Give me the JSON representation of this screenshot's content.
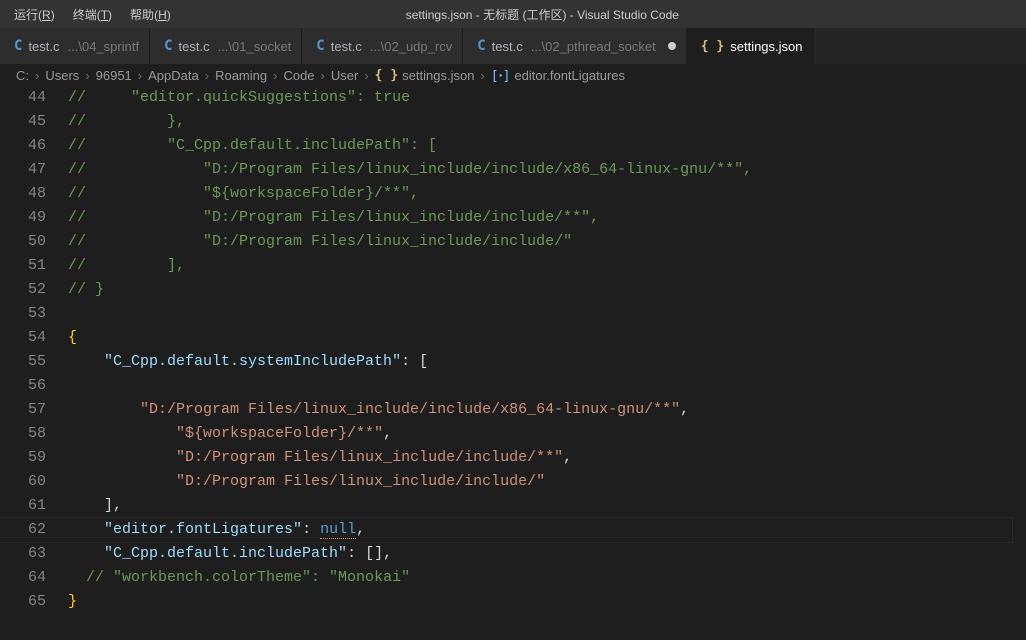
{
  "menubar": {
    "run": {
      "label": "运行",
      "accel": "R"
    },
    "term": {
      "label": "终端",
      "accel": "T"
    },
    "help": {
      "label": "帮助",
      "accel": "H"
    }
  },
  "title": "settings.json - 无标题 (工作区) - Visual Studio Code",
  "tabs": [
    {
      "icon": "C",
      "name": "test.c",
      "path": "...\\04_sprintf",
      "dirty": false,
      "active": false
    },
    {
      "icon": "C",
      "name": "test.c",
      "path": "...\\01_socket",
      "dirty": false,
      "active": false
    },
    {
      "icon": "C",
      "name": "test.c",
      "path": "...\\02_udp_rcv",
      "dirty": false,
      "active": false
    },
    {
      "icon": "C",
      "name": "test.c",
      "path": "...\\02_pthread_socket",
      "dirty": true,
      "active": false
    },
    {
      "icon": "{}",
      "name": "settings.json",
      "path": "",
      "dirty": false,
      "active": true
    }
  ],
  "breadcrumb": {
    "path": [
      "C:",
      "Users",
      "96951",
      "AppData",
      "Roaming",
      "Code",
      "User"
    ],
    "file": "settings.json",
    "symbol": "editor.fontLigatures",
    "symbol_icon": "[ꞏ]"
  },
  "firstLine": 44,
  "currentLine": 62,
  "code": [
    [
      {
        "cls": "tok-comment",
        "t": "// "
      },
      {
        "cls": "tok-comment",
        "t": "    \"editor.quickSuggestions\": true"
      }
    ],
    [
      {
        "cls": "tok-comment",
        "t": "//         },"
      }
    ],
    [
      {
        "cls": "tok-comment",
        "t": "//         \"C_Cpp.default.includePath\": ["
      }
    ],
    [
      {
        "cls": "tok-comment",
        "t": "//             \"D:/Program Files/linux_include/include/x86_64-linux-gnu/**\","
      }
    ],
    [
      {
        "cls": "tok-comment",
        "t": "//             \"${workspaceFolder}/**\","
      }
    ],
    [
      {
        "cls": "tok-comment",
        "t": "//             \"D:/Program Files/linux_include/include/**\","
      }
    ],
    [
      {
        "cls": "tok-comment",
        "t": "//             \"D:/Program Files/linux_include/include/\""
      }
    ],
    [
      {
        "cls": "tok-comment",
        "t": "//         ],"
      }
    ],
    [
      {
        "cls": "tok-comment",
        "t": "// }"
      }
    ],
    [],
    [
      {
        "cls": "tok-brace",
        "t": "{"
      }
    ],
    [
      {
        "cls": "tok-punc",
        "t": "    "
      },
      {
        "cls": "tok-prop",
        "t": "\"C_Cpp.default.systemIncludePath\""
      },
      {
        "cls": "tok-punc",
        "t": ": ["
      }
    ],
    [],
    [
      {
        "cls": "tok-punc",
        "t": "        "
      },
      {
        "cls": "tok-string",
        "t": "\"D:/Program Files/linux_include/include/x86_64-linux-gnu/**\""
      },
      {
        "cls": "tok-punc",
        "t": ","
      }
    ],
    [
      {
        "cls": "tok-punc",
        "t": "            "
      },
      {
        "cls": "tok-string",
        "t": "\"${workspaceFolder}/**\""
      },
      {
        "cls": "tok-punc",
        "t": ","
      }
    ],
    [
      {
        "cls": "tok-punc",
        "t": "            "
      },
      {
        "cls": "tok-string",
        "t": "\"D:/Program Files/linux_include/include/**\""
      },
      {
        "cls": "tok-punc",
        "t": ","
      }
    ],
    [
      {
        "cls": "tok-punc",
        "t": "            "
      },
      {
        "cls": "tok-string",
        "t": "\"D:/Program Files/linux_include/include/\""
      }
    ],
    [
      {
        "cls": "tok-punc",
        "t": "    ],"
      }
    ],
    [
      {
        "cls": "tok-punc",
        "t": "    "
      },
      {
        "cls": "tok-prop",
        "t": "\"editor.fontLigatures\""
      },
      {
        "cls": "tok-punc",
        "t": ": "
      },
      {
        "cls": "tok-null null-squiggle",
        "t": "null"
      },
      {
        "cls": "tok-punc",
        "t": ","
      }
    ],
    [
      {
        "cls": "tok-punc",
        "t": "    "
      },
      {
        "cls": "tok-prop",
        "t": "\"C_Cpp.default.includePath\""
      },
      {
        "cls": "tok-punc",
        "t": ": [],"
      }
    ],
    [
      {
        "cls": "tok-punc",
        "t": "  "
      },
      {
        "cls": "tok-comment",
        "t": "// \"workbench.colorTheme\": \"Monokai\""
      }
    ],
    [
      {
        "cls": "tok-brace",
        "t": "}"
      }
    ]
  ]
}
